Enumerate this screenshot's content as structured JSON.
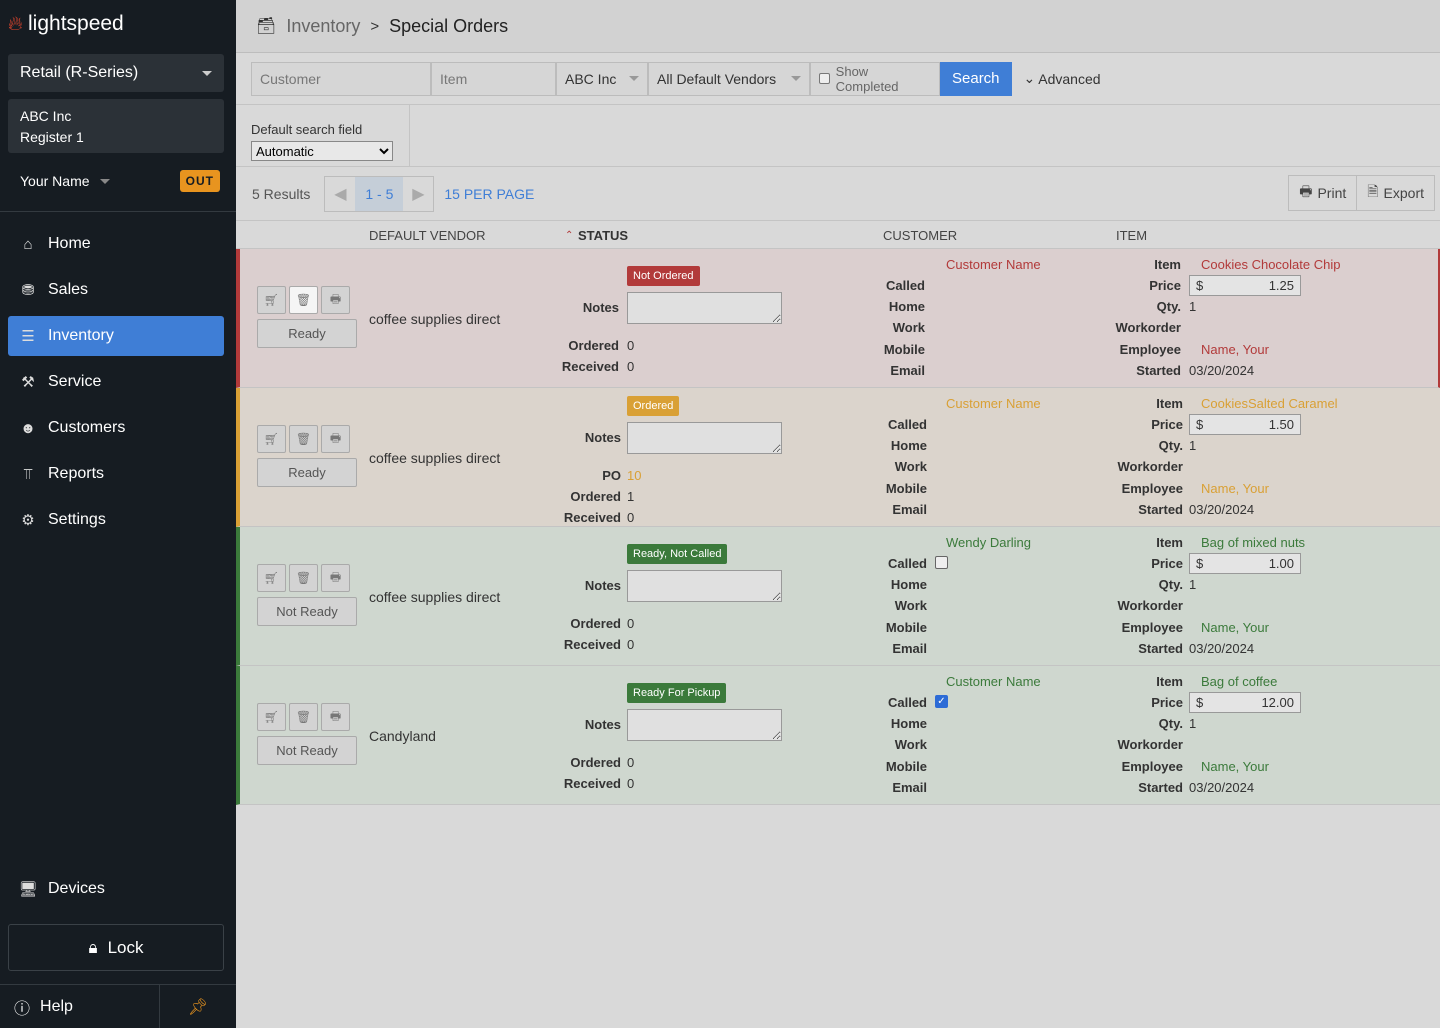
{
  "sidebar": {
    "brand": "lightspeed",
    "store": "Retail (R-Series)",
    "register": {
      "company": "ABC Inc",
      "name": "Register 1"
    },
    "user": "Your Name",
    "out_label": "OUT",
    "nav": [
      {
        "label": "Home",
        "icon": "home-icon"
      },
      {
        "label": "Sales",
        "icon": "sales-icon"
      },
      {
        "label": "Inventory",
        "icon": "inventory-icon",
        "active": true
      },
      {
        "label": "Service",
        "icon": "service-icon"
      },
      {
        "label": "Customers",
        "icon": "customers-icon"
      },
      {
        "label": "Reports",
        "icon": "reports-icon"
      },
      {
        "label": "Settings",
        "icon": "settings-icon"
      }
    ],
    "devices": "Devices",
    "lock": "Lock",
    "help": "Help"
  },
  "header": {
    "breadcrumb_parent": "Inventory",
    "breadcrumb_sep": ">",
    "title": "Special Orders"
  },
  "search": {
    "customer_placeholder": "Customer",
    "item_placeholder": "Item",
    "shop": "ABC Inc",
    "vendor": "All Default Vendors",
    "show_completed": "Show Completed",
    "search_label": "Search",
    "advanced_label": "Advanced",
    "default_search_label": "Default search field",
    "default_search_value": "Automatic"
  },
  "pager": {
    "results": "5 Results",
    "range": "1 - 5",
    "per_page": "15 PER PAGE",
    "print": "Print",
    "export": "Export"
  },
  "columns": {
    "vendor": "DEFAULT VENDOR",
    "status": "STATUS",
    "customer": "CUSTOMER",
    "item": "ITEM"
  },
  "labels": {
    "notes": "Notes",
    "po": "PO",
    "ordered": "Ordered",
    "received": "Received",
    "called": "Called",
    "home": "Home",
    "work": "Work",
    "mobile": "Mobile",
    "email": "Email",
    "item": "Item",
    "price": "Price",
    "qty": "Qty.",
    "workorder": "Workorder",
    "employee": "Employee",
    "started": "Started",
    "currency": "$"
  },
  "rows": [
    {
      "ready_btn": "Ready",
      "vendor": "coffee supplies direct",
      "status": "Not Ordered",
      "status_color": "#b23a3a",
      "po": "",
      "ordered": "0",
      "received": "0",
      "customer": "Customer Name",
      "customer_color": "#b23a3a",
      "called": null,
      "item": "Cookies Chocolate Chip",
      "price": "1.25",
      "qty": "1",
      "employee": "Name, Your",
      "started": "03/20/2024"
    },
    {
      "ready_btn": "Ready",
      "vendor": "coffee supplies direct",
      "status": "Ordered",
      "status_color": "#d9a035",
      "po": "10",
      "ordered": "1",
      "received": "0",
      "customer": "Customer Name",
      "customer_color": "#d9a035",
      "called": null,
      "item": "CookiesSalted Caramel",
      "price": "1.50",
      "qty": "1",
      "employee": "Name, Your",
      "started": "03/20/2024"
    },
    {
      "ready_btn": "Not Ready",
      "vendor": "coffee supplies direct",
      "status": "Ready, Not Called",
      "status_color": "#3b7a3b",
      "po": "",
      "ordered": "0",
      "received": "0",
      "customer": "Wendy Darling",
      "customer_color": "#3b7a3b",
      "called": false,
      "item": "Bag of mixed nuts",
      "price": "1.00",
      "qty": "1",
      "employee": "Name, Your",
      "started": "03/20/2024"
    },
    {
      "ready_btn": "Not Ready",
      "vendor": "Candyland",
      "status": "Ready For Pickup",
      "status_color": "#3b7a3b",
      "po": "",
      "ordered": "0",
      "received": "0",
      "customer": "Customer Name",
      "customer_color": "#3b7a3b",
      "called": true,
      "item": "Bag of coffee",
      "price": "12.00",
      "qty": "1",
      "employee": "Name, Your",
      "started": "03/20/2024"
    }
  ]
}
